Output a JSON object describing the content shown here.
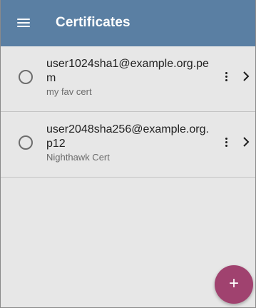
{
  "app_bar": {
    "title": "Certificates",
    "menu_icon": "hamburger-menu-icon",
    "background_color": "#5a7fa3"
  },
  "certificates": [
    {
      "name": "user1024sha1@example.org.pem",
      "description": "my fav cert",
      "selected": false
    },
    {
      "name": "user2048sha256@example.org.p12",
      "description": "Nighthawk Cert",
      "selected": false
    }
  ],
  "row_icons": {
    "radio": "radio-unchecked-icon",
    "more": "more-vertical-icon",
    "open": "chevron-right-icon"
  },
  "fab": {
    "label": "+",
    "icon": "add-icon",
    "color": "#a0426f"
  }
}
